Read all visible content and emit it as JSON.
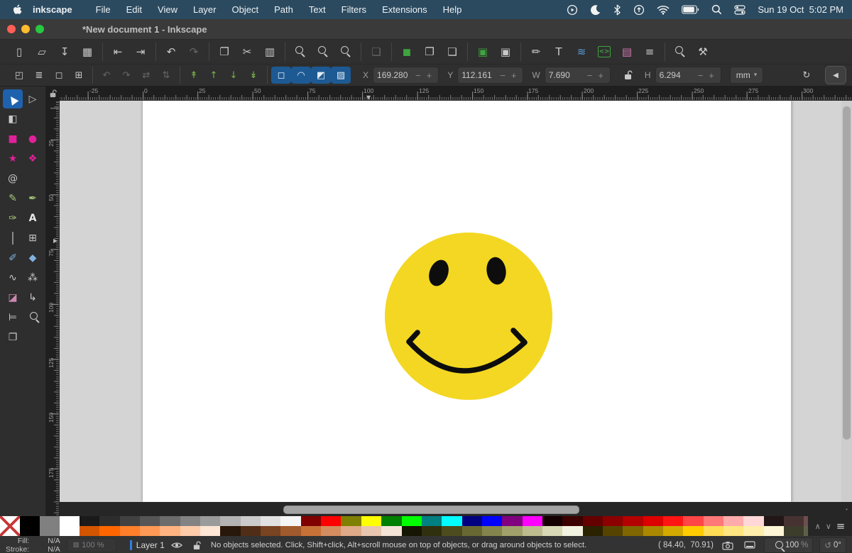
{
  "menubar": {
    "app_name": "inkscape",
    "items": [
      {
        "t": "File"
      },
      {
        "t": "Edit"
      },
      {
        "t": "View"
      },
      {
        "t": "Layer"
      },
      {
        "t": "Object"
      },
      {
        "t": "Path"
      },
      {
        "t": "Text"
      },
      {
        "t": "Filters"
      },
      {
        "t": "Extensions"
      },
      {
        "t": "Help"
      }
    ],
    "clock": "Sun 19 Oct  5:02 PM"
  },
  "titlebar": {
    "title": "*New document 1 - Inkscape",
    "close_color": "#ff5f57",
    "minimize_color": "#febc2e",
    "maximize_color": "#28c840"
  },
  "command_toolbar": {
    "groups": [
      {
        "icons": [
          {
            "n": "new-document-icon",
            "g": "▯"
          },
          {
            "n": "open-document-icon",
            "g": "▱"
          },
          {
            "n": "save-document-icon",
            "g": "↧"
          },
          {
            "n": "print-icon",
            "g": "▦"
          }
        ]
      },
      {
        "icons": [
          {
            "n": "import-icon",
            "g": "⇤"
          },
          {
            "n": "export-icon",
            "g": "⇥"
          }
        ]
      },
      {
        "icons": [
          {
            "n": "undo-icon",
            "g": "↶"
          },
          {
            "n": "redo-icon",
            "g": "↷",
            "d": "1"
          }
        ]
      },
      {
        "icons": [
          {
            "n": "copy-icon",
            "g": "❐"
          },
          {
            "n": "cut-icon",
            "g": "✂"
          },
          {
            "n": "paste-icon",
            "g": "▥"
          }
        ]
      },
      {
        "icons": [
          {
            "n": "zoom-drawing-icon",
            "k": "mag"
          },
          {
            "n": "zoom-page-icon",
            "k": "mag"
          },
          {
            "n": "zoom-selection-icon",
            "k": "mag"
          }
        ]
      },
      {
        "icons": [
          {
            "n": "fit-selection-icon",
            "g": "❑",
            "d": "1"
          }
        ]
      },
      {
        "icons": [
          {
            "n": "duplicate-icon",
            "g": "◼",
            "c": "#3fa33f"
          },
          {
            "n": "clone-icon",
            "g": "❐"
          },
          {
            "n": "unlink-clone-icon",
            "g": "❏"
          }
        ]
      },
      {
        "icons": [
          {
            "n": "group-icon",
            "g": "▣",
            "c": "#3fa33f"
          },
          {
            "n": "ungroup-icon",
            "g": "▣"
          }
        ]
      },
      {
        "icons": [
          {
            "n": "fill-stroke-icon",
            "g": "✏"
          },
          {
            "n": "text-dialog-icon",
            "g": "T"
          },
          {
            "n": "layers-dialog-icon",
            "g": "≋",
            "c": "#5b9bd5"
          },
          {
            "n": "xml-editor-icon",
            "g": "<>",
            "k": "boxed",
            "c": "#3fa33f"
          },
          {
            "n": "document-properties-icon",
            "g": "▤",
            "c": "#d078b0"
          },
          {
            "n": "align-dialog-icon",
            "g": "≡"
          }
        ]
      },
      {
        "icons": [
          {
            "n": "find-icon",
            "k": "mag"
          },
          {
            "n": "preferences-icon",
            "g": "⚒"
          }
        ]
      }
    ]
  },
  "tool_controls": {
    "groups": [
      {
        "icons": [
          {
            "n": "select-all-icon",
            "g": "◰"
          },
          {
            "n": "select-all-layers-icon",
            "g": "≣"
          },
          {
            "n": "deselect-icon",
            "g": "◻"
          },
          {
            "n": "selection-box-icon",
            "g": "⊞"
          }
        ]
      },
      {
        "icons": [
          {
            "n": "rotate-ccw-icon",
            "g": "↶",
            "d": "1"
          },
          {
            "n": "rotate-cw-icon",
            "g": "↷",
            "d": "1"
          },
          {
            "n": "flip-horizontal-icon",
            "g": "⇄",
            "d": "1"
          },
          {
            "n": "flip-vertical-icon",
            "g": "⇅",
            "d": "1"
          }
        ]
      },
      {
        "icons": [
          {
            "n": "raise-to-top-icon",
            "g": "↟",
            "c": "#7ab648"
          },
          {
            "n": "raise-icon",
            "g": "↑",
            "c": "#7ab648"
          },
          {
            "n": "lower-icon",
            "g": "↓",
            "c": "#7ab648"
          },
          {
            "n": "lower-to-bottom-icon",
            "g": "↡",
            "c": "#7ab648"
          }
        ]
      },
      {
        "icons": [
          {
            "n": "move-as-group-toggle",
            "g": "◻",
            "s": "1"
          },
          {
            "n": "transform-stroke-toggle",
            "g": "◠",
            "s": "1"
          },
          {
            "n": "transform-corners-toggle",
            "g": "◩",
            "s": "1"
          },
          {
            "n": "transform-gradient-toggle",
            "g": "▨",
            "s": "1"
          }
        ]
      }
    ],
    "fields": {
      "x": {
        "label": "X",
        "value": "169.280"
      },
      "y": {
        "label": "Y",
        "value": "112.161"
      },
      "w": {
        "label": "W",
        "value": "7.690"
      },
      "h": {
        "label": "H",
        "value": "6.294"
      }
    },
    "minus": "−",
    "plus": "+",
    "unit": "mm",
    "caret": "▾",
    "snap_glyph": "↻",
    "collapse_glyph": "◀"
  },
  "toolbox": {
    "tools": [
      {
        "n": "selector-tool",
        "g": "▲",
        "c": "#ffffff",
        "s": "1"
      },
      {
        "n": "node-tool",
        "g": "▷"
      },
      {
        "n": "shape-builder-tool",
        "g": "◧"
      },
      {
        "sp": "1"
      },
      {
        "n": "rectangle-tool",
        "g": "■",
        "c": "#e0219a"
      },
      {
        "n": "ellipse-tool",
        "g": "●",
        "c": "#e0219a"
      },
      {
        "n": "star-tool",
        "g": "★",
        "c": "#e0219a"
      },
      {
        "n": "box-3d-tool",
        "g": "❖",
        "c": "#e0219a"
      },
      {
        "n": "spiral-tool",
        "g": "@",
        "c": "#c9c9c9"
      },
      {
        "sp": "1"
      },
      {
        "n": "pencil-tool",
        "g": "✎",
        "c": "#a7c879"
      },
      {
        "n": "pen-tool",
        "g": "✒",
        "c": "#a7c879"
      },
      {
        "n": "calligraphy-tool",
        "g": "✑",
        "c": "#a7c879"
      },
      {
        "n": "text-tool",
        "g": "A"
      },
      {
        "n": "gradient-tool",
        "k": "grad"
      },
      {
        "n": "mesh-gradient-tool",
        "g": "⊞"
      },
      {
        "n": "dropper-tool",
        "g": "✐",
        "c": "#7fb2de"
      },
      {
        "n": "paint-bucket-tool",
        "g": "◆",
        "c": "#7fb2de"
      },
      {
        "n": "tweak-tool",
        "g": "∿"
      },
      {
        "n": "spray-tool",
        "g": "⁂"
      },
      {
        "n": "eraser-tool",
        "g": "◪",
        "c": "#cd87b0"
      },
      {
        "n": "connector-tool",
        "g": "↳"
      },
      {
        "n": "measure-tool",
        "g": "⊨"
      },
      {
        "n": "zoom-tool",
        "k": "mag"
      },
      {
        "n": "pages-tool",
        "g": "❐"
      }
    ]
  },
  "rulers": {
    "h_labels": [
      {
        "t": "-25",
        "s": "left:62px"
      },
      {
        "t": "0",
        "s": "left:139px"
      },
      {
        "t": "25",
        "s": "left:216px"
      },
      {
        "t": "50",
        "s": "left:294px"
      },
      {
        "t": "75",
        "s": "left:371px"
      },
      {
        "t": "100",
        "s": "left:448px"
      },
      {
        "t": "125",
        "s": "left:526px"
      },
      {
        "t": "150",
        "s": "left:603px"
      },
      {
        "t": "175",
        "s": "left:680px"
      },
      {
        "t": "200",
        "s": "left:758px"
      },
      {
        "t": "225",
        "s": "left:835px"
      },
      {
        "t": "250",
        "s": "left:913px"
      },
      {
        "t": "275",
        "s": "left:990px"
      },
      {
        "t": "300",
        "s": "left:1067px"
      }
    ],
    "v_labels": [
      {
        "t": "25",
        "s": "top:55px"
      },
      {
        "t": "50",
        "s": "top:132px"
      },
      {
        "t": "75",
        "s": "top:210px"
      },
      {
        "t": "100",
        "s": "top:287px"
      },
      {
        "t": "125",
        "s": "top:365px"
      },
      {
        "t": "150",
        "s": "top:442px"
      },
      {
        "t": "175",
        "s": "top:520px"
      }
    ],
    "h_marker": "▼",
    "v_marker": "▶"
  },
  "canvas": {
    "page_color": "#ffffff",
    "face_color": "#f3d722",
    "feature_color": "#0d0d0d"
  },
  "palette": {
    "full_swatches": [
      {
        "n": "no-color-swatch",
        "k": "none"
      },
      {
        "n": "black-swatch",
        "c": "#000000"
      },
      {
        "n": "gray-swatch",
        "c": "#808080"
      },
      {
        "n": "white-swatch",
        "c": "#ffffff"
      }
    ],
    "row1": [
      {
        "c": "#1a1a1a"
      },
      {
        "c": "#2d2d2d"
      },
      {
        "c": "#414141"
      },
      {
        "c": "#565656"
      },
      {
        "c": "#6c6c6c"
      },
      {
        "c": "#838383"
      },
      {
        "c": "#9b9b9b"
      },
      {
        "c": "#b3b3b3"
      },
      {
        "c": "#cbcbcb"
      },
      {
        "c": "#e2e2e2"
      },
      {
        "c": "#f5f5f5"
      },
      {
        "c": "#800000"
      },
      {
        "c": "#ff0000"
      },
      {
        "c": "#808000"
      },
      {
        "c": "#ffff00"
      },
      {
        "c": "#008000"
      },
      {
        "c": "#00ff00"
      },
      {
        "c": "#008080"
      },
      {
        "c": "#00ffff"
      },
      {
        "c": "#000080"
      },
      {
        "c": "#0000ff"
      },
      {
        "c": "#800080"
      },
      {
        "c": "#ff00ff"
      },
      {
        "c": "#140000"
      },
      {
        "c": "#3c0000"
      },
      {
        "c": "#640000"
      },
      {
        "c": "#8c0000"
      },
      {
        "c": "#b40000"
      },
      {
        "c": "#dc0000"
      },
      {
        "c": "#ff1414"
      },
      {
        "c": "#ff4545"
      },
      {
        "c": "#ff7878"
      },
      {
        "c": "#ffabab"
      },
      {
        "c": "#ffd7d7"
      },
      {
        "c": "#221616"
      },
      {
        "c": "#473232"
      },
      {
        "c": "#6d4e4e"
      },
      {
        "c": "#926a6a"
      },
      {
        "c": "#b88888"
      },
      {
        "c": "#1f0d00"
      }
    ],
    "row2": [
      {
        "c": "#d45500"
      },
      {
        "c": "#ff6600"
      },
      {
        "c": "#ff7f2a"
      },
      {
        "c": "#ff9955"
      },
      {
        "c": "#ffb380"
      },
      {
        "c": "#ffccaa"
      },
      {
        "c": "#ffe6d5"
      },
      {
        "c": "#28170b"
      },
      {
        "c": "#502d16"
      },
      {
        "c": "#784421"
      },
      {
        "c": "#a05a2c"
      },
      {
        "c": "#c87137"
      },
      {
        "c": "#d38d5f"
      },
      {
        "c": "#deaa87"
      },
      {
        "c": "#e9c6af"
      },
      {
        "c": "#f4e3d7"
      },
      {
        "c": "#161605"
      },
      {
        "c": "#30300f"
      },
      {
        "c": "#4c4c1f"
      },
      {
        "c": "#686833"
      },
      {
        "c": "#84844d"
      },
      {
        "c": "#a0a06b"
      },
      {
        "c": "#bcbc8f"
      },
      {
        "c": "#d8d8b6"
      },
      {
        "c": "#f2f2e0"
      },
      {
        "c": "#2b2200"
      },
      {
        "c": "#554400"
      },
      {
        "c": "#806600"
      },
      {
        "c": "#aa8800"
      },
      {
        "c": "#d4aa00"
      },
      {
        "c": "#ffcc00"
      },
      {
        "c": "#ffdd55"
      },
      {
        "c": "#ffe680"
      },
      {
        "c": "#ffeeaa"
      },
      {
        "c": "#fff6d5"
      },
      {
        "c": "#3d3d2b"
      },
      {
        "c": "#60604a"
      },
      {
        "c": "#83836b"
      },
      {
        "c": "#a6a68e"
      },
      {
        "c": "#2d5016"
      }
    ],
    "scroll_up": "∧",
    "scroll_down": "∨",
    "menu": "≡"
  },
  "statusbar": {
    "fill_label": "Fill:",
    "fill_value": "N/A",
    "stroke_label": "Stroke:",
    "stroke_value": "N/A",
    "opacity_icon": "▨",
    "opacity_value": "100 %",
    "layer_indicator_color": "#2f7fe0",
    "layer_label": "Layer 1",
    "message": "No objects selected. Click, Shift+click, Alt+scroll mouse on top of objects, or drag around objects to select.",
    "coords": "( 84.40,  70.91)",
    "zoom_value": "100",
    "zoom_unit": "%",
    "rotation_icon": "↺",
    "rotation_value": "0°"
  }
}
